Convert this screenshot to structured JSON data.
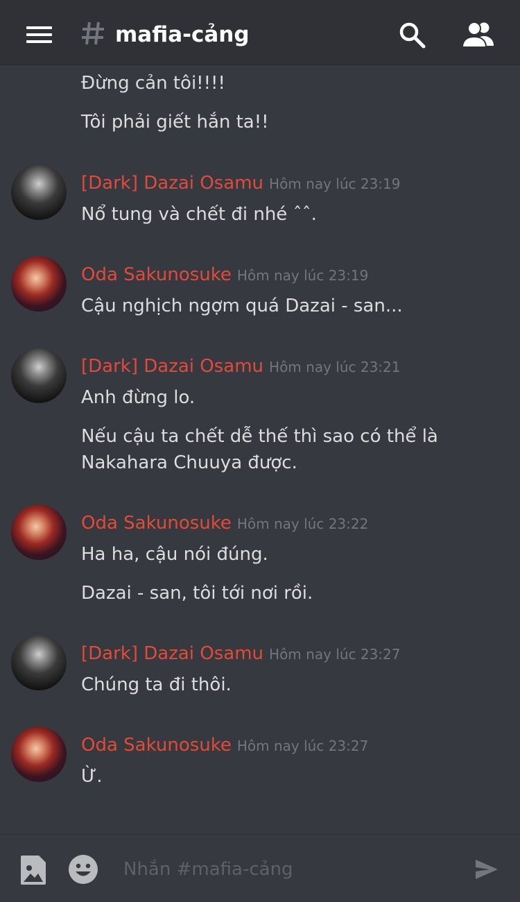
{
  "header": {
    "menu_icon": "hamburger-menu-icon",
    "channel_icon": "hash-icon",
    "channel_name": "mafia-cảng",
    "search_icon": "search-icon",
    "members_icon": "members-icon"
  },
  "colors": {
    "background": "#36393f",
    "header_background": "#2f3136",
    "author_name": "#e24b3a",
    "message_text": "#dcddde",
    "timestamp": "#72767d",
    "placeholder": "#5d6168"
  },
  "messages": {
    "orphan_lines": [
      "Đừng cản tôi!!!!",
      "Tôi phải giết hắn ta!!"
    ],
    "groups": [
      {
        "author": "[Dark] Dazai Osamu",
        "timestamp": "Hôm nay lúc 23:19",
        "lines": [
          "Nổ tung và chết đi nhé ˆˆ."
        ]
      },
      {
        "author": "Oda Sakunosuke",
        "timestamp": "Hôm nay lúc 23:19",
        "lines": [
          "Cậu nghịch ngợm quá Dazai - san..."
        ]
      },
      {
        "author": "[Dark] Dazai Osamu",
        "timestamp": "Hôm nay lúc 23:21",
        "lines": [
          "Anh đừng lo.",
          "Nếu cậu ta chết dễ thế thì sao có thể là",
          "Nakahara Chuuya được."
        ]
      },
      {
        "author": "Oda Sakunosuke",
        "timestamp": "Hôm nay lúc 23:22",
        "lines": [
          "Ha ha, cậu nói đúng.",
          "Dazai - san, tôi tới nơi rồi."
        ]
      },
      {
        "author": "[Dark] Dazai Osamu",
        "timestamp": "Hôm nay lúc 23:27",
        "lines": [
          "Chúng ta đi thôi."
        ]
      },
      {
        "author": "Oda Sakunosuke",
        "timestamp": "Hôm nay lúc 23:27",
        "lines": [
          "Ừ."
        ]
      }
    ]
  },
  "composer": {
    "image_icon": "image-upload-icon",
    "emoji_icon": "emoji-icon",
    "placeholder": "Nhắn #mafia-cảng",
    "value": "",
    "send_icon": "send-icon"
  }
}
